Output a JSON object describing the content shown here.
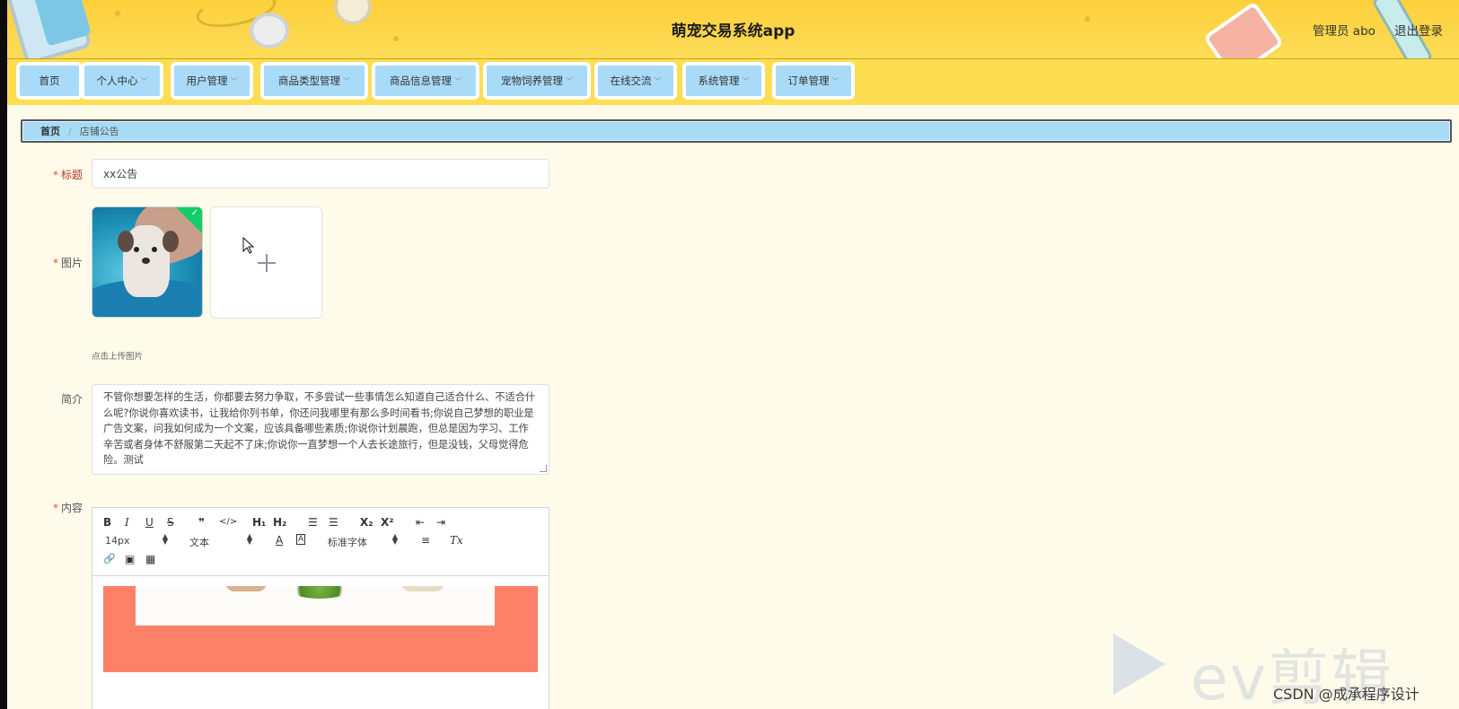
{
  "header": {
    "app_title": "萌宠交易系统app",
    "user_label": "管理员 abo",
    "logout_label": "退出登录"
  },
  "nav": {
    "items": [
      {
        "label": "首页",
        "has_dropdown": false
      },
      {
        "label": "个人中心",
        "has_dropdown": true
      },
      {
        "label": "用户管理",
        "has_dropdown": true
      },
      {
        "label": "商品类型管理",
        "has_dropdown": true
      },
      {
        "label": "商品信息管理",
        "has_dropdown": true
      },
      {
        "label": "宠物饲养管理",
        "has_dropdown": true
      },
      {
        "label": "在线交流",
        "has_dropdown": true
      },
      {
        "label": "系统管理",
        "has_dropdown": true
      },
      {
        "label": "订单管理",
        "has_dropdown": true
      }
    ]
  },
  "breadcrumb": {
    "home": "首页",
    "separator": "/",
    "current": "店铺公告"
  },
  "form": {
    "title_label": "标题",
    "title_value": "xx公告",
    "image_label": "图片",
    "upload_tip": "点击上传图片",
    "intro_label": "简介",
    "intro_value": "不管你想要怎样的生活，你都要去努力争取，不多尝试一些事情怎么知道自己适合什么、不适合什么呢?你说你喜欢读书，让我给你列书单，你还问我哪里有那么多时间看书;你说自己梦想的职业是广告文案，问我如何成为一个文案，应该具备哪些素质;你说你计划晨跑，但总是因为学习、工作辛苦或者身体不舒服第二天起不了床;你说你一直梦想一个人去长途旅行，但是没钱，父母觉得危险。测试",
    "content_label": "内容",
    "required_mark": "*"
  },
  "editor": {
    "toolbar": {
      "bold": "B",
      "italic": "I",
      "underline": "U",
      "strike": "S",
      "quote": "❞",
      "code": "</>",
      "h1": "H₁",
      "h2": "H₂",
      "ordered_list": "☰",
      "bullet_list": "☰",
      "subscript": "X₂",
      "superscript": "X²",
      "indent_less": "⇤",
      "indent_more": "⇥",
      "font_size": "14px",
      "header_select": "文本",
      "font_family": "标准字体",
      "color": "A",
      "background": "A",
      "align": "≡",
      "clean": "Tx",
      "link": "🔗",
      "image": "▣",
      "video": "▦"
    }
  },
  "watermark": {
    "brand_text": "ev剪辑",
    "csdn_text": "CSDN @成承程序设计"
  },
  "colors": {
    "header_bg": "#fcd03a",
    "nav_item_bg": "#a9dbf8",
    "breadcrumb_bg": "#a8dcf6",
    "page_bg": "#fffbea",
    "success_badge": "#13ce66"
  }
}
